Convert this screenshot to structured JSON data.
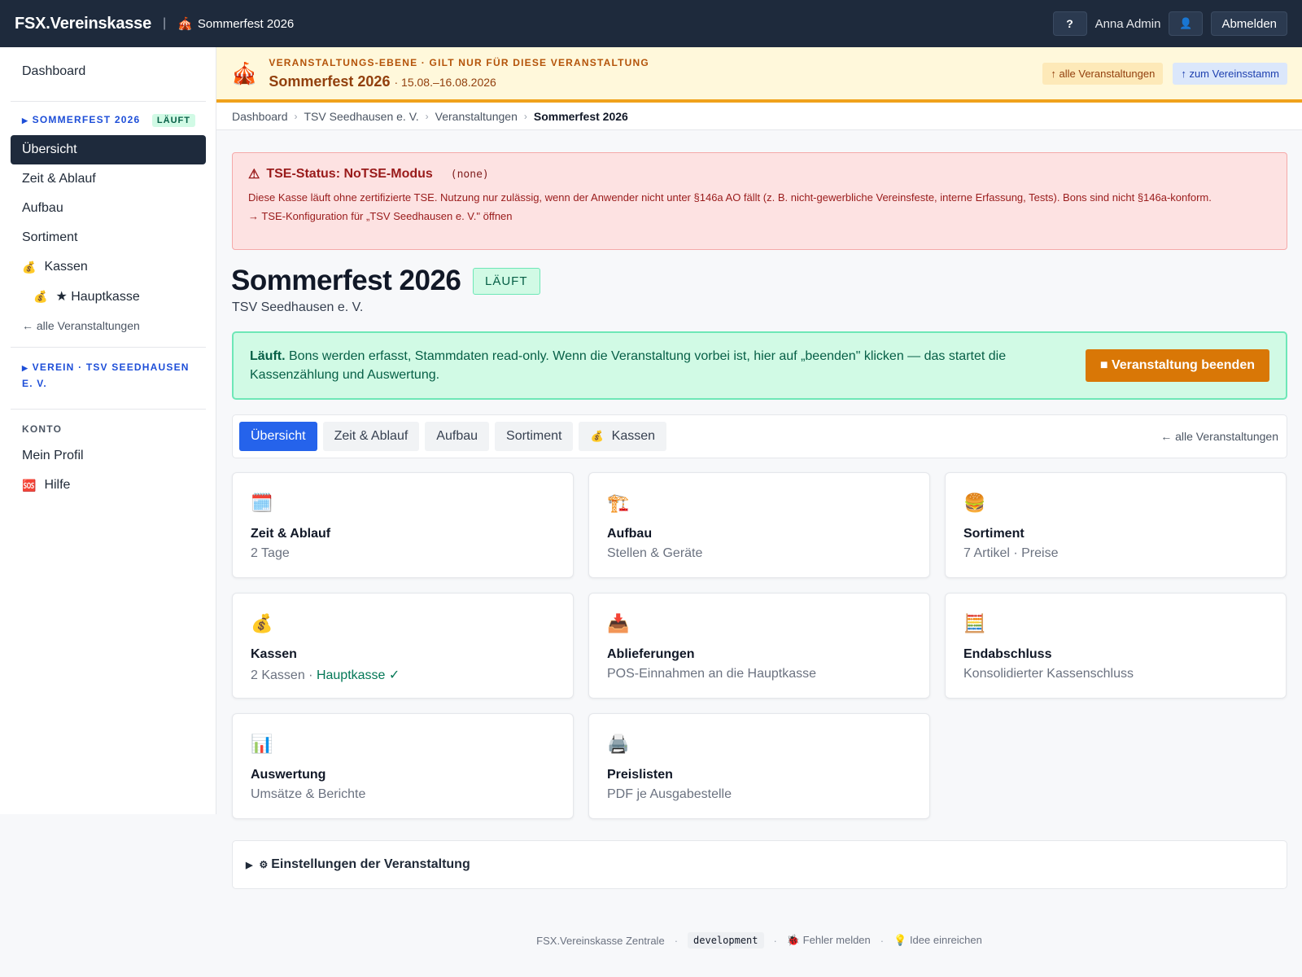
{
  "topbar": {
    "brand": "FSX.Vereinskasse",
    "event_icon": "circus-tent-icon",
    "event": "Sommerfest 2026",
    "help": "?",
    "user": "Anna Admin",
    "avatar_icon": "user-icon",
    "logout": "Abmelden"
  },
  "sidebar": {
    "dashboard": "Dashboard",
    "event_section": "SOMMERFEST 2026",
    "event_badge": "LÄUFT",
    "items": [
      {
        "label": "Übersicht",
        "active": true
      },
      {
        "label": "Zeit & Ablauf"
      },
      {
        "label": "Aufbau"
      },
      {
        "label": "Sortiment"
      },
      {
        "label": "Kassen",
        "icon": "money-bag-icon"
      },
      {
        "label": "★ Hauptkasse",
        "icon": "money-bag-icon"
      }
    ],
    "back_link": "← alle Veranstaltungen",
    "verein_section_line1": "VEREIN · TSV SEEDHAUSEN",
    "verein_section_line2": "E. V.",
    "konto": "KONTO",
    "profile": "Mein Profil",
    "help": "Hilfe",
    "help_icon": "sos-icon"
  },
  "banner": {
    "level": "VERANSTALTUNGS-EBENE · GILT NUR FÜR DIESE VERANSTALTUNG",
    "title": "Sommerfest 2026",
    "dates": "· 15.08.–16.08.2026",
    "btn_all": "↑ alle Veranstaltungen",
    "btn_stamm": "↑ zum Vereinsstamm",
    "accent": "#f0a21c"
  },
  "breadcrumb": [
    "Dashboard",
    "TSV Seedhausen e. V.",
    "Veranstaltungen",
    "Sommerfest 2026"
  ],
  "tse": {
    "title": "TSE-Status: NoTSE-Modus",
    "code": "(none)",
    "body": "Diese Kasse läuft ohne zertifizierte TSE. Nutzung nur zulässig, wenn der Anwender nicht unter §146a AO fällt (z. B. nicht-gewerbliche Vereinsfeste, interne Erfassung, Tests). Bons sind nicht §146a-konform.",
    "link": "→ TSE-Konfiguration für „TSV Seedhausen e. V.\" öffnen"
  },
  "page": {
    "title": "Sommerfest 2026",
    "status": "LÄUFT",
    "subtitle": "TSV Seedhausen e. V."
  },
  "running": {
    "bold": "Läuft.",
    "text": " Bons werden erfasst, Stammdaten read-only. Wenn die Veranstaltung vorbei ist, hier auf „beenden\" klicken — das startet die Kassenzählung und Auswertung.",
    "button": "■ Veranstaltung beenden"
  },
  "tabs": {
    "items": [
      "Übersicht",
      "Zeit & Ablauf",
      "Aufbau",
      "Sortiment",
      "Kassen"
    ],
    "back": "← alle Veranstaltungen"
  },
  "cards": [
    {
      "icon": "calendar-icon",
      "title": "Zeit & Ablauf",
      "sub": "2 Tage"
    },
    {
      "icon": "crane-icon",
      "title": "Aufbau",
      "sub": "Stellen & Geräte"
    },
    {
      "icon": "burger-icon",
      "title": "Sortiment",
      "sub": "7 Artikel · Preise"
    },
    {
      "icon": "money-bag-icon",
      "title": "Kassen",
      "sub": "2 Kassen · ",
      "sub_ok": "Hauptkasse ✓"
    },
    {
      "icon": "inbox-tray-icon",
      "title": "Ablieferungen",
      "sub": "POS-Einnahmen an die Hauptkasse"
    },
    {
      "icon": "abacus-icon",
      "title": "Endabschluss",
      "sub": "Konsolidierter Kassenschluss"
    },
    {
      "icon": "bar-chart-icon",
      "title": "Auswertung",
      "sub": "Umsätze & Berichte"
    },
    {
      "icon": "printer-icon",
      "title": "Preislisten",
      "sub": "PDF je Ausgabestelle"
    }
  ],
  "settings": {
    "label": "Einstellungen der Veranstaltung"
  },
  "footer": {
    "brand": "FSX.Vereinskasse Zentrale",
    "env": "development",
    "bug": "Fehler melden",
    "idea": "Idee einreichen"
  }
}
